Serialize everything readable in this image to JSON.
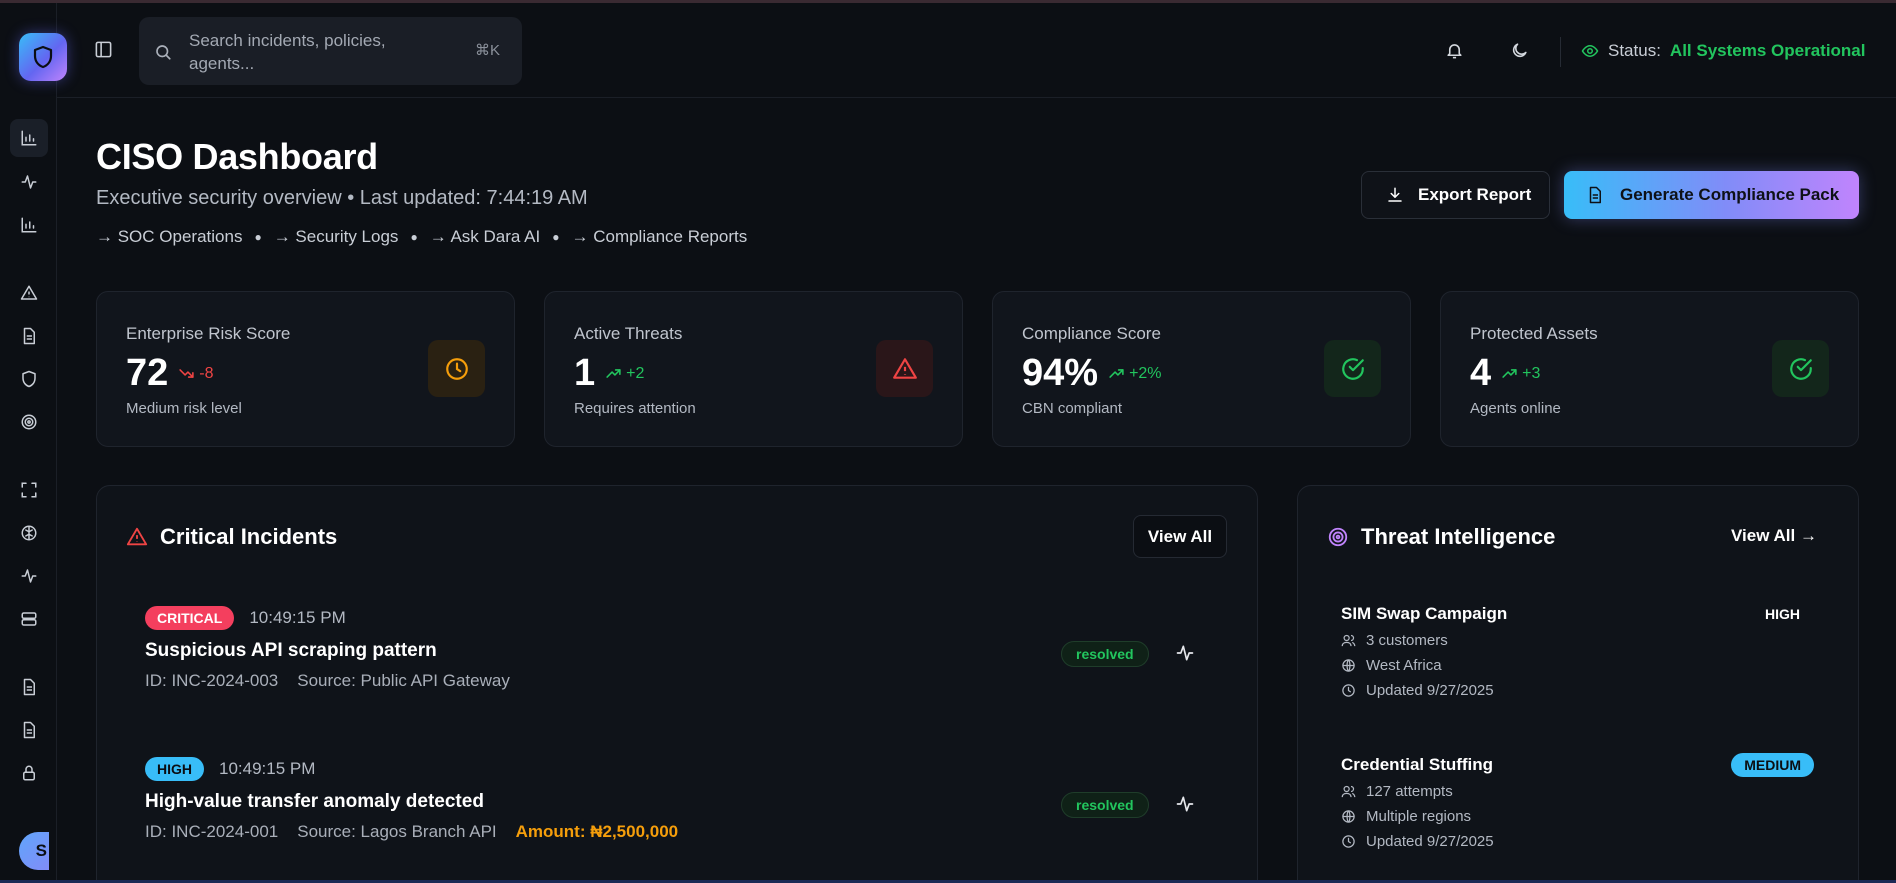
{
  "header": {
    "search_placeholder": "Search incidents, policies, agents...",
    "search_shortcut": "⌘K",
    "status_label": "Status:",
    "status_value": "All Systems Operational",
    "status_color": "#22c55e"
  },
  "sidebar": {
    "icons": [
      "bar-chart-icon",
      "activity-icon",
      "bar-chart-icon",
      "alert-triangle-icon",
      "file-text-icon",
      "shield-icon",
      "target-icon",
      "scan-icon",
      "brain-icon",
      "activity-icon",
      "server-icon",
      "file-text-icon",
      "file-text-icon",
      "lock-icon"
    ],
    "avatar_initial": "S"
  },
  "page": {
    "title": "CISO Dashboard",
    "subtitle": "Executive security overview • Last updated: 7:44:19 AM",
    "quick_links": [
      "→ SOC Operations",
      "→ Security Logs",
      "→ Ask Dara AI",
      "→ Compliance Reports"
    ],
    "export_label": "Export Report",
    "generate_label": "Generate Compliance Pack"
  },
  "stats": [
    {
      "label": "Enterprise Risk Score",
      "value": "72",
      "delta": "-8",
      "trend": "down",
      "sub": "Medium risk level",
      "icon": "clock-icon",
      "color": "#f59e0b"
    },
    {
      "label": "Active Threats",
      "value": "1",
      "delta": "+2",
      "trend": "up",
      "sub": "Requires attention",
      "icon": "alert-triangle-icon",
      "color": "#ef4444"
    },
    {
      "label": "Compliance Score",
      "value": "94%",
      "delta": "+2%",
      "trend": "up",
      "sub": "CBN compliant",
      "icon": "check-circle-icon",
      "color": "#22c55e"
    },
    {
      "label": "Protected Assets",
      "value": "4",
      "delta": "+3",
      "trend": "up",
      "sub": "Agents online",
      "icon": "check-circle-icon",
      "color": "#22c55e"
    }
  ],
  "incidents_panel": {
    "title": "Critical Incidents",
    "view_all": "View All",
    "items": [
      {
        "severity": "CRITICAL",
        "time": "10:49:15 PM",
        "title": "Suspicious API scraping pattern",
        "id": "ID: INC-2024-003",
        "source": "Source: Public API Gateway",
        "amount": "",
        "status": "resolved"
      },
      {
        "severity": "HIGH",
        "time": "10:49:15 PM",
        "title": "High-value transfer anomaly detected",
        "id": "ID: INC-2024-001",
        "source": "Source: Lagos Branch API",
        "amount": "Amount: ₦2,500,000",
        "status": "resolved"
      }
    ]
  },
  "intel_panel": {
    "title": "Threat Intelligence",
    "view_all": "View All →",
    "items": [
      {
        "name": "SIM Swap Campaign",
        "severity": "HIGH",
        "targets": "3 customers",
        "region": "West Africa",
        "updated": "Updated 9/27/2025"
      },
      {
        "name": "Credential Stuffing",
        "severity": "MEDIUM",
        "targets": "127 attempts",
        "region": "Multiple regions",
        "updated": "Updated 9/27/2025"
      }
    ]
  }
}
